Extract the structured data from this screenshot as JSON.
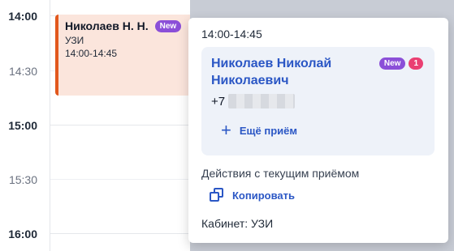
{
  "time_slots": [
    {
      "label": "14:00",
      "kind": "hour"
    },
    {
      "label": "14:30",
      "kind": "half"
    },
    {
      "label": "15:00",
      "kind": "hour"
    },
    {
      "label": "15:30",
      "kind": "half"
    },
    {
      "label": "16:00",
      "kind": "hour"
    }
  ],
  "event": {
    "short_name": "Николаев Н. Н.",
    "badge": "New",
    "service": "УЗИ",
    "time": "14:00-14:45",
    "accent_color": "#e2581d",
    "bg_color": "#fbe5dc"
  },
  "popover": {
    "time": "14:00-14:45",
    "patient_name": "Николаев Николай Николаевич",
    "badge_new": "New",
    "badge_count": "1",
    "phone_prefix": "+7",
    "another_label": "Ещё приём",
    "actions_title": "Действия с текущим приёмом",
    "copy_label": "Копировать",
    "cabinet": "Кабинет: УЗИ",
    "link_color": "#2b57c5"
  },
  "icons": {
    "plus": "plus-icon",
    "copy": "copy-icon"
  }
}
